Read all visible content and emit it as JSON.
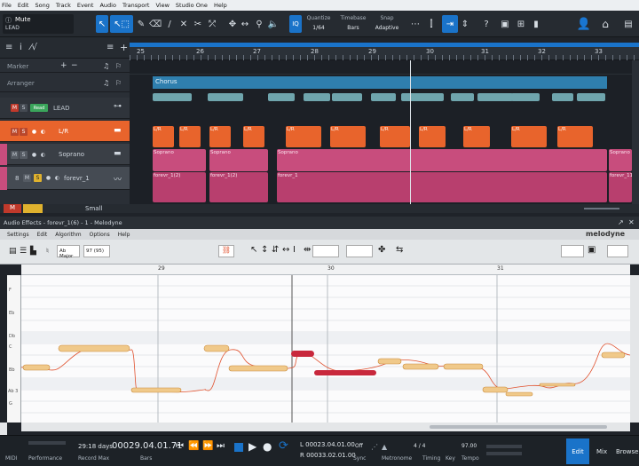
{
  "menu": [
    "File",
    "Edit",
    "Song",
    "Track",
    "Event",
    "Audio",
    "Transport",
    "View",
    "Studio One",
    "Help"
  ],
  "toolbar": {
    "track_name": "Mute",
    "track_sub": "LEAD",
    "quantize_label": "Quantize",
    "quantize_value": "1/64",
    "timebase_label": "Timebase",
    "timebase_value": "Bars",
    "snap_label": "Snap",
    "snap_value": "Adaptive",
    "iq_label": "IQ"
  },
  "ruler_bars": [
    "25",
    "26",
    "27",
    "28",
    "29",
    "30",
    "31",
    "32",
    "33"
  ],
  "tracklist": {
    "marker_label": "Marker",
    "arranger_label": "Arranger",
    "tracks": [
      {
        "m": "M",
        "s": "S",
        "read": "Read",
        "name": "LEAD"
      },
      {
        "m": "M",
        "s": "S",
        "name": "L/R"
      },
      {
        "m": "M",
        "s": "S",
        "name": "Soprano"
      },
      {
        "num": "8",
        "m": "M",
        "s": "S",
        "name": "forevr_1"
      }
    ],
    "bottom_left": "M",
    "bottom_size": "Small"
  },
  "arranger": {
    "section": "Chorus"
  },
  "clips": {
    "orange_label": "L/R",
    "pink_label": "Soprano",
    "pink2_label": "forevr_1",
    "pink3_label": "forevr_1(2)",
    "pink4_label": "forevr_11"
  },
  "melodyne": {
    "title": "Audio Effects - forevr_1(6) - 1 - Melodyne",
    "menu": [
      "Settings",
      "Edit",
      "Algorithm",
      "Options",
      "Help"
    ],
    "brand": "melodyne",
    "scale": "Ab Major",
    "tempo_field": "97 (95)",
    "ruler": [
      "29",
      "30",
      "31"
    ],
    "piano": [
      "F",
      "Eb",
      "Db",
      "C",
      "Bb",
      "Ab 3",
      "G"
    ]
  },
  "transport": {
    "midi_label": "MIDI",
    "performance_label": "Performance",
    "days": "29:18 days",
    "record_max": "Record Max",
    "position": "00029.04.01.71",
    "pos_unit": "Bars",
    "loop_l": "L  00023.04.01.00",
    "loop_r": "R  00033.02.01.00",
    "sync_value": "Off",
    "sync_label": "Sync",
    "metronome_label": "Metronome",
    "timing_label": "Timing",
    "timesig": "4 / 4",
    "key_label": "Key",
    "tempo_value": "97.00",
    "tempo_label": "Tempo",
    "edit_label": "Edit",
    "mix_label": "Mix",
    "browse_label": "Browse"
  },
  "colors": {
    "accent": "#1a73c9",
    "orange": "#e8642c",
    "pink": "#c84d7d",
    "teal": "#6fa5ad",
    "note": "#f0c98a",
    "note_selected": "#c8283c"
  }
}
